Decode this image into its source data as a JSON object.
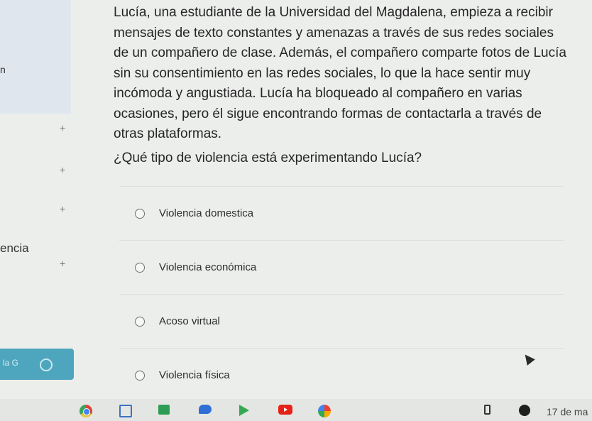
{
  "question": {
    "paragraph": "Lucía, una estudiante de la Universidad del Magdalena, empieza a recibir mensajes de texto constantes y amenazas a través de sus redes sociales de un compañero de clase. Además, el compañero comparte fotos de Lucía sin su consentimiento en las redes sociales, lo que la hace sentir muy incómoda y angustiada. Lucía ha bloqueado al compañero en varias ocasiones, pero él sigue encontrando formas de contactarla a través de otras plataformas.",
    "prompt": "¿Qué tipo de violencia está experimentando Lucía?"
  },
  "options": [
    {
      "label": "Violencia domestica"
    },
    {
      "label": "Violencia económica"
    },
    {
      "label": "Acoso virtual"
    },
    {
      "label": "Violencia física"
    }
  ],
  "left_panel": {
    "fragment": "n",
    "side_word": "encia",
    "chip_label": "la G",
    "plus": "+"
  },
  "taskbar": {
    "icons": [
      "chrome-icon",
      "files-icon",
      "meet-icon",
      "chat-icon",
      "play-store-icon",
      "youtube-icon",
      "photos-icon",
      "battery-icon",
      "notification-icon"
    ],
    "clock": "17 de ma"
  }
}
